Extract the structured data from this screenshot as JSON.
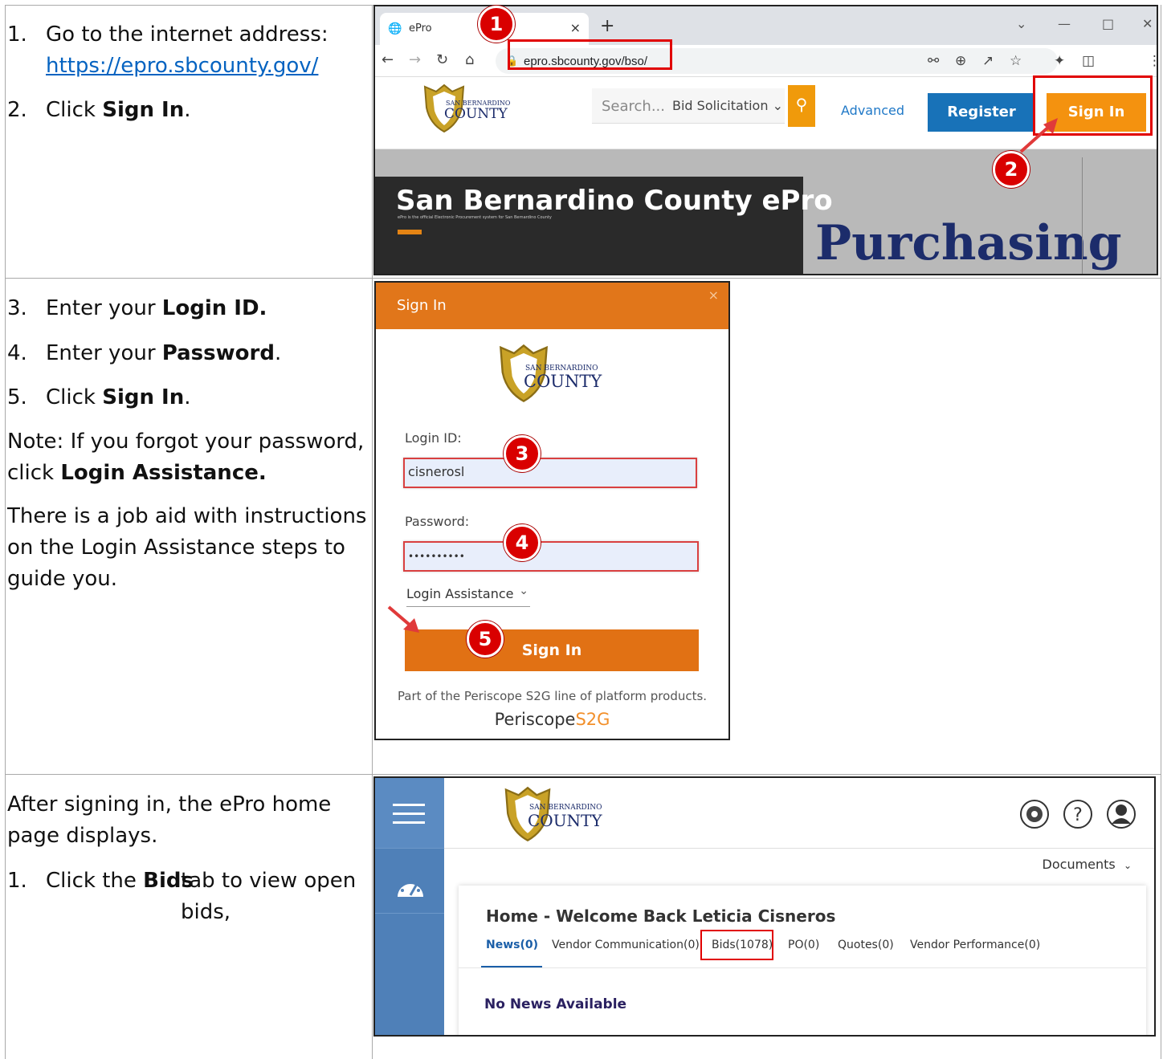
{
  "instructions": {
    "row1": {
      "step1_num": "1.",
      "step1_text": "Go to the internet address:",
      "step1_link": "https://epro.sbcounty.gov/",
      "step2_num": "2.",
      "step2_pre": "Click ",
      "step2_bold": "Sign In",
      "step2_post": "."
    },
    "row2": {
      "step3_num": "3.",
      "step3_pre": "Enter your ",
      "step3_bold": "Login ID.",
      "step4_num": "4.",
      "step4_pre": "Enter your ",
      "step4_bold": "Password",
      "step4_post": ".",
      "step5_num": "5.",
      "step5_pre": "Click ",
      "step5_bold": "Sign In",
      "step5_post": ".",
      "note_pre": "Note: If you forgot your password, click ",
      "note_bold": "Login Assistance.",
      "jobaid": "There is a job aid with instructions on the Login Assistance steps to guide you."
    },
    "row3": {
      "intro": "After signing in, the ePro home page displays.",
      "step1_num": "1.",
      "step1_pre": "Click the ",
      "step1_bold": "Bids",
      "step1_post": " tab to view open bids,"
    }
  },
  "markers": [
    "1",
    "2",
    "3",
    "4",
    "5"
  ],
  "browser": {
    "tab_title": "ePro",
    "tab_close": "×",
    "new_tab": "+",
    "url": "epro.sbcounty.gov/bso/",
    "search_placeholder": "Search...",
    "search_category": "Bid Solicitation",
    "advanced": "Advanced",
    "register": "Register",
    "sign_in": "Sign In",
    "hero_title": "San Bernardino County ePro",
    "hero_sub": "ePro is the official Electronic Procurement system for San Bernardino County",
    "hero_right": "Purchasing"
  },
  "logo": {
    "small": "SAN BERNARDINO",
    "big": "COUNTY"
  },
  "modal": {
    "title": "Sign In",
    "close": "×",
    "login_label": "Login ID:",
    "login_value": "cisnerosl",
    "password_label": "Password:",
    "password_value": "••••••••••",
    "assist": "Login Assistance",
    "signin_button": "Sign In",
    "footer": "Part of the Periscope S2G line of platform products.",
    "brand_1": "Periscope",
    "brand_2": "S2G"
  },
  "home": {
    "documents": "Documents",
    "title": "Home - Welcome Back Leticia Cisneros",
    "tabs": [
      "News(0)",
      "Vendor Communication(0)",
      "Bids(1078)",
      "PO(0)",
      "Quotes(0)",
      "Vendor Performance(0)"
    ],
    "no_news": "No News Available"
  },
  "colors": {
    "accent_orange": "#f4920f",
    "register_blue": "#1872b8",
    "marker_red": "#d90000",
    "sidebar_blue": "#4f80b8"
  }
}
